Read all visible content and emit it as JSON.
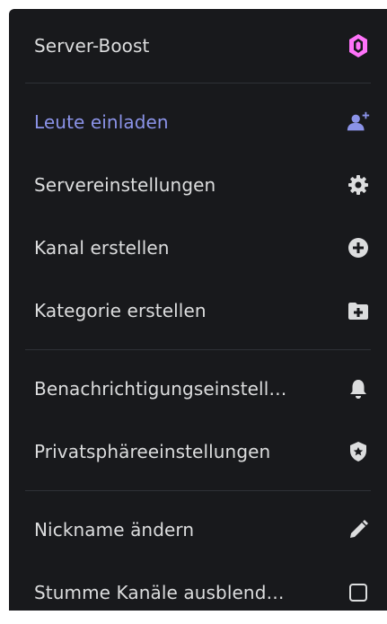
{
  "menu": {
    "server_boost": {
      "label": "Server-Boost",
      "icon": "boost-gem-icon",
      "accent": "#ff73fa"
    },
    "invite": {
      "label": "Leute einladen",
      "icon": "add-user-icon",
      "accent": "#8b93e8"
    },
    "settings": {
      "label": "Servereinstellungen",
      "icon": "gear-icon"
    },
    "create_channel": {
      "label": "Kanal erstellen",
      "icon": "plus-circle-icon"
    },
    "create_category": {
      "label": "Kategorie erstellen",
      "icon": "folder-plus-icon"
    },
    "notifications": {
      "label": "Benachrichtigungseinstell…",
      "icon": "bell-icon"
    },
    "privacy": {
      "label": "Privatsphäreeinstellungen",
      "icon": "shield-icon"
    },
    "nickname": {
      "label": "Nickname ändern",
      "icon": "pencil-icon"
    },
    "hide_muted": {
      "label": "Stumme Kanäle ausblend…",
      "icon": "checkbox-icon",
      "checked": false
    }
  }
}
